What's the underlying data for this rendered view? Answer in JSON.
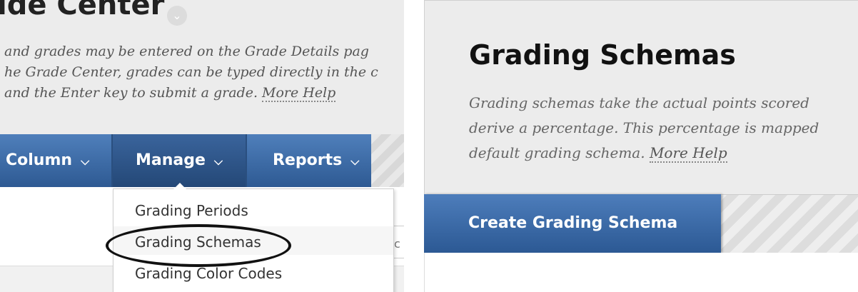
{
  "left": {
    "title": "ide Center",
    "description_lines": [
      "and grades may be entered on the Grade Details pag",
      "he Grade Center, grades can be typed directly in the c",
      " and the Enter key to submit a grade. "
    ],
    "more_help": "More Help",
    "tabs": {
      "column": "Column",
      "manage": "Manage",
      "reports": "Reports"
    },
    "menu": [
      "Grading Periods",
      "Grading Schemas",
      "Grading Color Codes"
    ],
    "side_letter": "c"
  },
  "right": {
    "title": "Grading Schemas",
    "description_lines": [
      "Grading schemas take the actual points scored ",
      "derive a percentage. This percentage is mapped",
      "default grading schema. "
    ],
    "more_help": "More Help",
    "create_button": "Create Grading Schema"
  },
  "icons": {
    "chevron": "chevron-down-icon"
  },
  "colors": {
    "tab_blue": "#3d6ba6",
    "tab_active": "#2a5081"
  }
}
